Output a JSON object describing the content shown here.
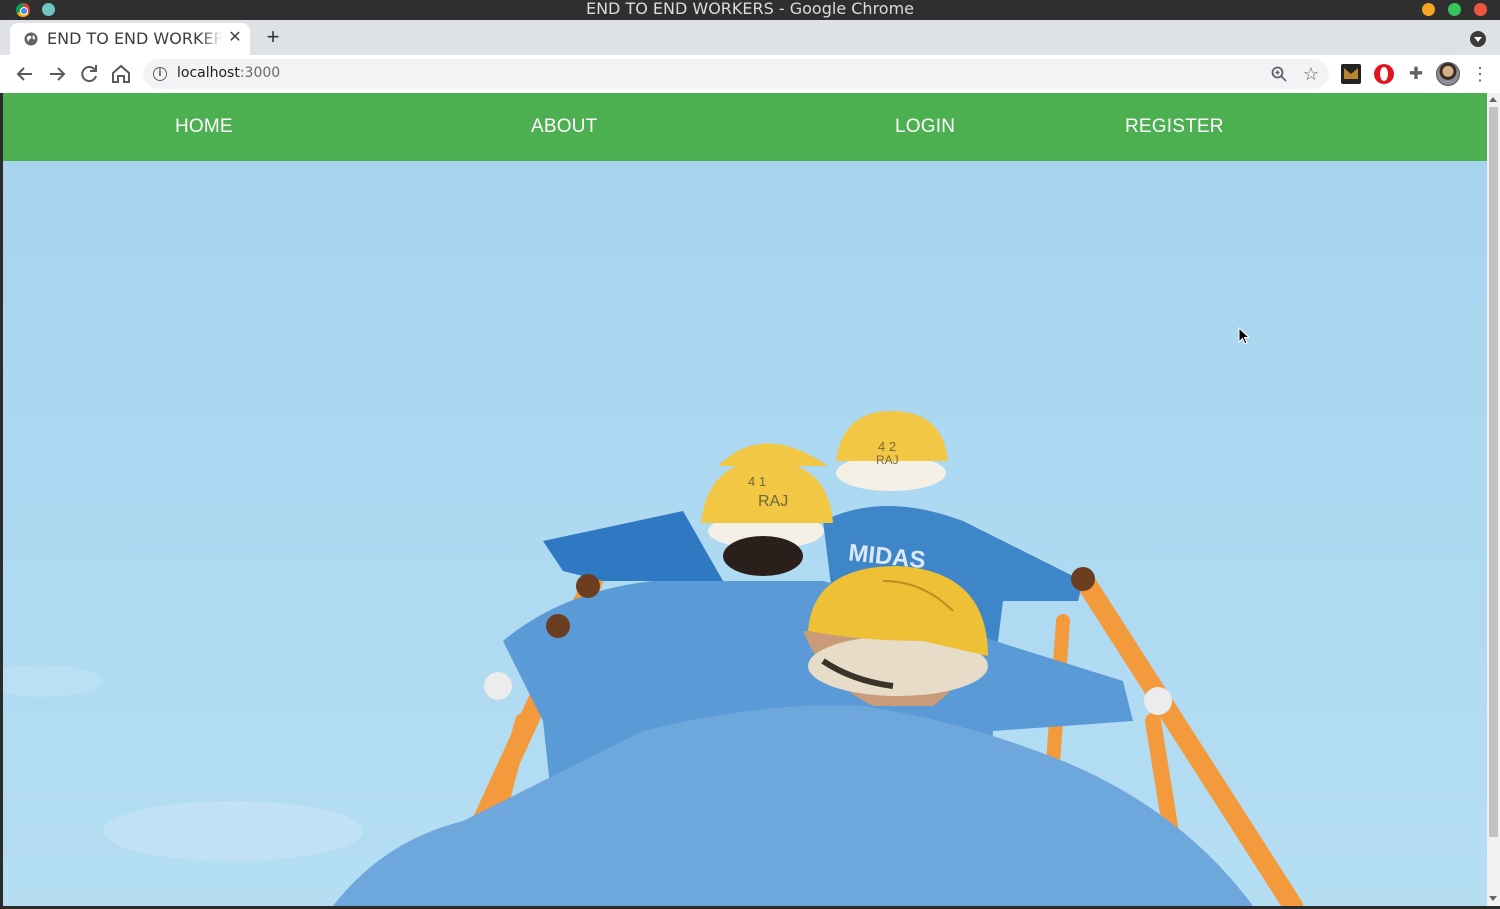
{
  "window": {
    "title": "END TO END WORKERS - Google Chrome"
  },
  "tabs": [
    {
      "label": "END TO END WORKERS",
      "active": true
    }
  ],
  "toolbar": {
    "url_host": "localhost",
    "url_port": ":3000"
  },
  "page": {
    "nav": {
      "home": "HOME",
      "about": "ABOUT",
      "login": "LOGIN",
      "register": "REGISTER"
    },
    "hero_image": {
      "helmet_text_1": "4 1",
      "helmet_text_2": "RAJ",
      "helmet_text_3": "4 2",
      "helmet_text_4": "RAJ",
      "shirt_text": "MIDAS"
    }
  },
  "colors": {
    "nav_background": "#4caf50",
    "sky": "#a9d5ef",
    "helmet": "#f2c744",
    "uniform": "#4a8fcb",
    "rail": "#f39a3c"
  }
}
